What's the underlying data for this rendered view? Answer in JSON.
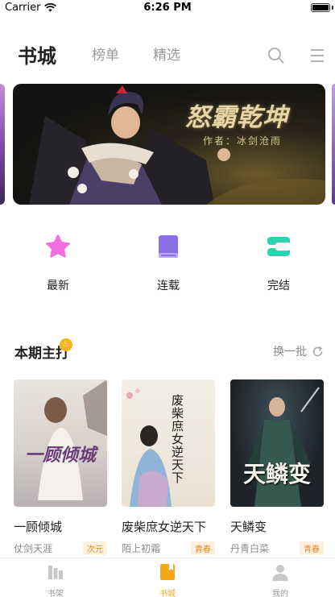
{
  "status_bar": {
    "carrier": "Carrier",
    "time": "6:26 PM",
    "battery_level": 1.0
  },
  "header": {
    "tabs": [
      {
        "label": "书城",
        "active": true
      },
      {
        "label": "榜单",
        "active": false
      },
      {
        "label": "精选",
        "active": false
      }
    ],
    "icons": [
      "search-icon",
      "menu-icon"
    ]
  },
  "banner": {
    "title": "怒霸乾坤",
    "author_line": "作者：冰剑沧雨"
  },
  "categories": [
    {
      "label": "最新",
      "icon": "star-icon",
      "color": "#f56fe0"
    },
    {
      "label": "连载",
      "icon": "book-icon",
      "color": "#8b6fe8"
    },
    {
      "label": "完结",
      "icon": "stack-icon",
      "color": "#2fd3b0"
    }
  ],
  "section": {
    "title": "本期主打",
    "badge": "hot-icon",
    "refresh_label": "换一批"
  },
  "books": [
    {
      "title": "一顾倾城",
      "author": "仗剑天涯",
      "tag": "次元",
      "cover_text": "一顾倾城"
    },
    {
      "title": "废柴庶女逆天下",
      "author": "陌上初霜",
      "tag": "青春",
      "cover_text": "废柴庶女逆天下"
    },
    {
      "title": "天鳞变",
      "author": "丹青白菜",
      "tag": "青春",
      "cover_text": "天鳞变"
    }
  ],
  "tabbar": [
    {
      "label": "书架",
      "active": false
    },
    {
      "label": "书城",
      "active": true
    },
    {
      "label": "我的",
      "active": false
    }
  ],
  "colors": {
    "accent": "#f3a81c",
    "tag_bg": "#fdf1dd",
    "tag_text": "#e08a2a"
  }
}
